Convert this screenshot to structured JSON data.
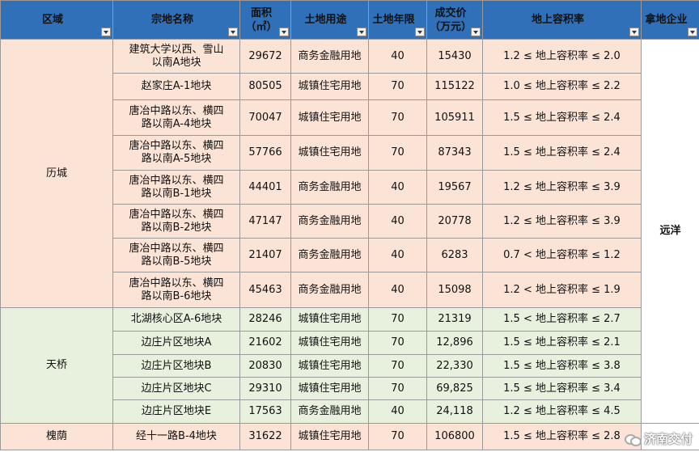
{
  "headers": [
    "区域",
    "宗地名称",
    "面积（㎡）",
    "土地用途",
    "土地年限",
    "成交价（万元）",
    "地上容积率",
    "拿地企业"
  ],
  "header_lines": {
    "area": [
      "面积",
      "（㎡）"
    ],
    "price": [
      "成交价",
      "（万元）"
    ]
  },
  "regions": [
    {
      "name": "历城",
      "rows": 8
    },
    {
      "name": "天桥",
      "rows": 5
    },
    {
      "name": "槐荫",
      "rows": 1
    }
  ],
  "company": "远洋",
  "rows": [
    {
      "name": [
        "建筑大学以西、雪山",
        "以南A地块"
      ],
      "area": "29672",
      "use": "商务金融用地",
      "years": "40",
      "price": "15430",
      "ratio": "1.2 ≤ 地上容积率 ≤ 2.0"
    },
    {
      "name": [
        "赵家庄A-1地块"
      ],
      "area": "80505",
      "use": "城镇住宅用地",
      "years": "70",
      "price": "115122",
      "ratio": "1.0 ≤ 地上容积率 ≤ 2.2"
    },
    {
      "name": [
        "唐冶中路以东、横四",
        "路以南A-4地块"
      ],
      "area": "70047",
      "use": "城镇住宅用地",
      "years": "70",
      "price": "105911",
      "ratio": "1.5 ≤ 地上容积率 ≤ 2.4"
    },
    {
      "name": [
        "唐冶中路以东、横四",
        "路以南A-5地块"
      ],
      "area": "57766",
      "use": "城镇住宅用地",
      "years": "70",
      "price": "87343",
      "ratio": "1.5 ≤ 地上容积率 ≤ 2.4"
    },
    {
      "name": [
        "唐冶中路以东、横四",
        "路以南B-1地块"
      ],
      "area": "44401",
      "use": "商务金融用地",
      "years": "40",
      "price": "19567",
      "ratio": "1.2 ≤ 地上容积率 ≤ 3.9"
    },
    {
      "name": [
        "唐冶中路以东、横四",
        "路以南B-2地块"
      ],
      "area": "47147",
      "use": "商务金融用地",
      "years": "40",
      "price": "20778",
      "ratio": "1.2 ≤ 地上容积率 ≤ 3.9"
    },
    {
      "name": [
        "唐冶中路以东、横四",
        "路以南B-5地块"
      ],
      "area": "21407",
      "use": "商务金融用地",
      "years": "40",
      "price": "6283",
      "ratio": "0.7 < 地上容积率 ≤ 1.2"
    },
    {
      "name": [
        "唐冶中路以东、横四",
        "路以南B-6地块"
      ],
      "area": "45463",
      "use": "商务金融用地",
      "years": "40",
      "price": "15098",
      "ratio": "1.2 < 地上容积率 ≤ 1.9"
    },
    {
      "name": [
        "北湖核心区A-6地块"
      ],
      "area": "28246",
      "use": "城镇住宅用地",
      "years": "70",
      "price": "21319",
      "ratio": "1.5 < 地上容积率 ≤ 2.7"
    },
    {
      "name": [
        "边庄片区地块A"
      ],
      "area": "21602",
      "use": "城镇住宅用地",
      "years": "70",
      "price": "12,896",
      "ratio": "1.5 ≤ 地上容积率 ≤ 2.1"
    },
    {
      "name": [
        "边庄片区地块B"
      ],
      "area": "20830",
      "use": "城镇住宅用地",
      "years": "70",
      "price": "22,330",
      "ratio": "1.5 ≤ 地上容积率 ≤ 3.8"
    },
    {
      "name": [
        "边庄片区地块C"
      ],
      "area": "29310",
      "use": "城镇住宅用地",
      "years": "70",
      "price": "69,825",
      "ratio": "1.5 ≤ 地上容积率 ≤ 3.4"
    },
    {
      "name": [
        "边庄片区地块E"
      ],
      "area": "17563",
      "use": "商务金融用地",
      "years": "40",
      "price": "24,118",
      "ratio": "1.2 ≤ 地上容积率 ≤ 4.5"
    },
    {
      "name": [
        "经十一路B-4地块"
      ],
      "area": "31622",
      "use": "城镇住宅用地",
      "years": "70",
      "price": "106800",
      "ratio": "1.5 ≤ 地上容积率 ≤ 2.8"
    }
  ],
  "watermark": "济南交付"
}
